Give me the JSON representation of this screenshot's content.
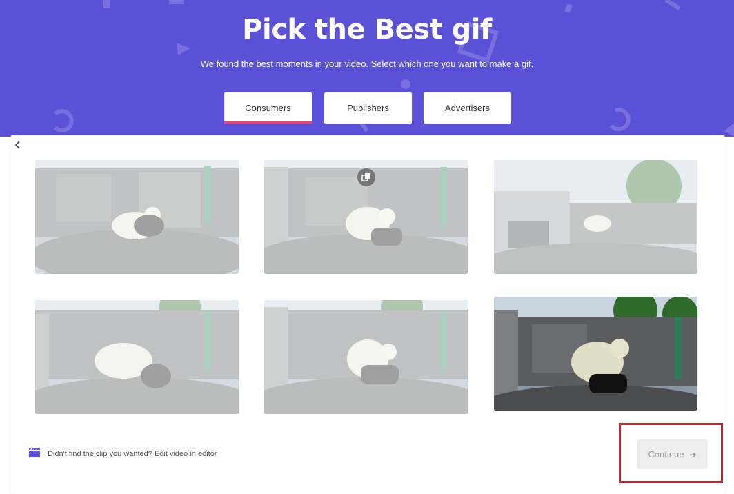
{
  "header": {
    "title": "Pick the Best gif",
    "subtitle": "We found the best moments in your video. Select which one you want to make a gif.",
    "background_color": "#5a51d7"
  },
  "tabs": [
    {
      "label": "Consumers",
      "active": true
    },
    {
      "label": "Publishers",
      "active": false
    },
    {
      "label": "Advertisers",
      "active": false
    }
  ],
  "accent_color": "#e0457b",
  "thumbnails": [
    {
      "name": "clip-1",
      "selected": false
    },
    {
      "name": "clip-2",
      "selected": false,
      "badge_icon": "copy-icon"
    },
    {
      "name": "clip-3",
      "selected": false
    },
    {
      "name": "clip-4",
      "selected": false
    },
    {
      "name": "clip-5",
      "selected": false
    },
    {
      "name": "clip-6",
      "selected": true
    }
  ],
  "footer": {
    "icon": "clapperboard-icon",
    "link_text": "Didn't find the clip you wanted? Edit video in editor"
  },
  "continue_button": {
    "label": "Continue",
    "icon": "arrow-right-icon",
    "enabled": false,
    "highlight_color": "#d21f26"
  }
}
